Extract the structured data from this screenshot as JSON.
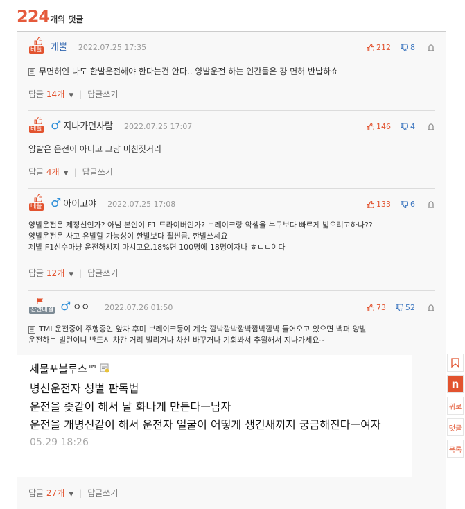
{
  "header": {
    "count": "224",
    "count_suffix": "개의 댓글"
  },
  "comments": [
    {
      "badge": "베플",
      "author": "개뿔",
      "date": "2022.07.25 17:35",
      "likes": "212",
      "dislikes": "8",
      "lines": [
        "무면허인 나도 한발운전해야 한다는건 안다.. 양발운전 하는 인간들은 걍 면허 반납하쇼"
      ],
      "reply_label": "답글",
      "reply_count": "14개",
      "write_label": "답글쓰기"
    },
    {
      "badge": "베플",
      "author": "지나가던사람",
      "date": "2022.07.25 17:07",
      "likes": "146",
      "dislikes": "4",
      "lines": [
        "양발은 운전이 아니고 그냥 미친짓거리"
      ],
      "reply_label": "답글",
      "reply_count": "4개",
      "write_label": "답글쓰기"
    },
    {
      "badge": "베플",
      "author": "아이고야",
      "date": "2022.07.25 17:08",
      "likes": "133",
      "dislikes": "6",
      "lines": [
        "양발운전은 제정신인가? 아님 본인이 F1 드라이버인가? 브레이크랑 악셀을 누구보다 빠르게 밟으려고하나??",
        "양발운전은 사고 유발할 가능성이 한발보다 훨씬큼. 한발쓰세요",
        "제발 F1선수마냥 운전하시지 마시고요.18%면 100명에 18명이자나 ㅎㄷㄷ이다"
      ],
      "reply_label": "답글",
      "reply_count": "12개",
      "write_label": "답글쓰기"
    },
    {
      "badge": "찬반대결",
      "author": "ㅇㅇ",
      "date": "2022.07.26 01:50",
      "likes": "73",
      "dislikes": "52",
      "lines": [
        "TMI 운전중에 주행중인 앞차 후미 브레이크등이 계속 깜박깜박깜박깜박깜박 들어오고 있으면 백퍼 양발",
        "운전하는 빌런이니 반드시 차간 거리 벌리거나 차선 바꾸거나 기회봐서 추월해서 지나가세요~"
      ],
      "quote": {
        "title": "제물포블루스™",
        "text": "병신운전자 성별 판독법\n운전을 좆같이 해서 날 화나게 만든다ㅡ남자\n운전을 개병신같이 해서 운전자 얼굴이 어떻게 생긴새끼지 궁금해진다ㅡ여자",
        "date": "05.29 18:26"
      },
      "reply_label": "답글",
      "reply_count": "27개",
      "write_label": "답글쓰기"
    }
  ],
  "side_buttons": [
    "위로",
    "댓글",
    "목록"
  ],
  "colors": {
    "accent": "#e2532f",
    "blue": "#3f78c0",
    "gender": "#2f8fd8"
  },
  "icons": [
    "thumb-up-icon",
    "thumb-down-icon",
    "report-icon",
    "doc-icon",
    "male-icon",
    "bookmark-icon",
    "nate-logo-icon"
  ]
}
